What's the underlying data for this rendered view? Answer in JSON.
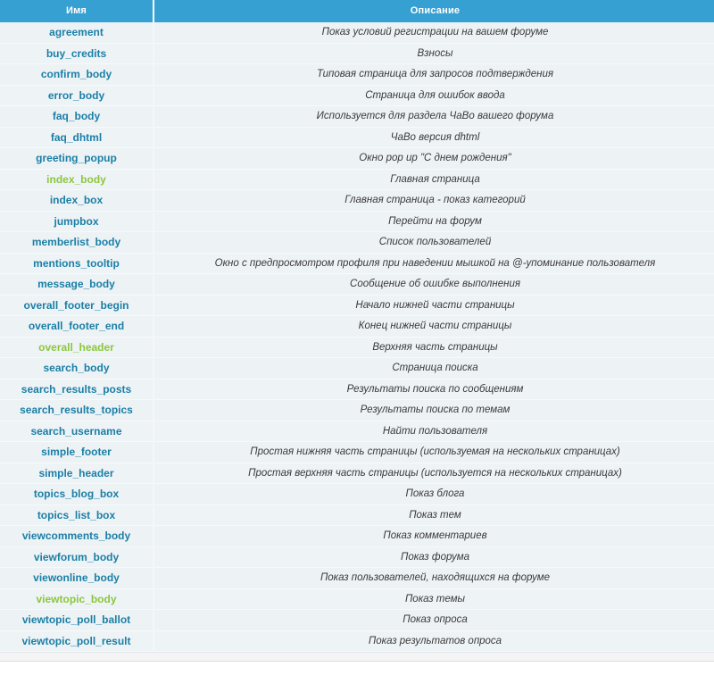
{
  "table": {
    "columns": [
      {
        "key": "name",
        "label": "Имя"
      },
      {
        "key": "description",
        "label": "Описание"
      }
    ],
    "accent_colors": {
      "link_blue": "#1b7fa6",
      "highlight_green": "#8cc63f",
      "header_background": "#37a0d3",
      "header_text": "#ffffff",
      "row_background": "#edf2f5",
      "description_text": "#3a3a3a"
    },
    "rows": [
      {
        "name": "agreement",
        "highlight": false,
        "description": "Показ условий регистрации на вашем форуме"
      },
      {
        "name": "buy_credits",
        "highlight": false,
        "description": "Взносы"
      },
      {
        "name": "confirm_body",
        "highlight": false,
        "description": "Типовая страница для запросов подтверждения"
      },
      {
        "name": "error_body",
        "highlight": false,
        "description": "Страница для ошибок ввода"
      },
      {
        "name": "faq_body",
        "highlight": false,
        "description": "Используется для раздела ЧаВо вашего форума"
      },
      {
        "name": "faq_dhtml",
        "highlight": false,
        "description": "ЧаВо версия dhtml"
      },
      {
        "name": "greeting_popup",
        "highlight": false,
        "description": "Окно pop up \"С днем рождения\""
      },
      {
        "name": "index_body",
        "highlight": true,
        "description": "Главная страница"
      },
      {
        "name": "index_box",
        "highlight": false,
        "description": "Главная страница - показ категорий"
      },
      {
        "name": "jumpbox",
        "highlight": false,
        "description": "Перейти на форум"
      },
      {
        "name": "memberlist_body",
        "highlight": false,
        "description": "Список пользователей"
      },
      {
        "name": "mentions_tooltip",
        "highlight": false,
        "description": "Окно с предпросмотром профиля при наведении мышкой на @-упоминание пользователя"
      },
      {
        "name": "message_body",
        "highlight": false,
        "description": "Сообщение об ошибке выполнения"
      },
      {
        "name": "overall_footer_begin",
        "highlight": false,
        "description": "Начало нижней части страницы"
      },
      {
        "name": "overall_footer_end",
        "highlight": false,
        "description": "Конец нижней части страницы"
      },
      {
        "name": "overall_header",
        "highlight": true,
        "description": "Верхняя часть страницы"
      },
      {
        "name": "search_body",
        "highlight": false,
        "description": "Страница поиска"
      },
      {
        "name": "search_results_posts",
        "highlight": false,
        "description": "Результаты поиска по сообщениям"
      },
      {
        "name": "search_results_topics",
        "highlight": false,
        "description": "Результаты поиска по темам"
      },
      {
        "name": "search_username",
        "highlight": false,
        "description": "Найти пользователя"
      },
      {
        "name": "simple_footer",
        "highlight": false,
        "description": "Простая нижняя часть страницы (используемая на нескольких страницах)"
      },
      {
        "name": "simple_header",
        "highlight": false,
        "description": "Простая верхняя часть страницы (используется на нескольких страницах)"
      },
      {
        "name": "topics_blog_box",
        "highlight": false,
        "description": "Показ блога"
      },
      {
        "name": "topics_list_box",
        "highlight": false,
        "description": "Показ тем"
      },
      {
        "name": "viewcomments_body",
        "highlight": false,
        "description": "Показ комментариев"
      },
      {
        "name": "viewforum_body",
        "highlight": false,
        "description": "Показ форума"
      },
      {
        "name": "viewonline_body",
        "highlight": false,
        "description": "Показ пользователей, находящихся на форуме"
      },
      {
        "name": "viewtopic_body",
        "highlight": true,
        "description": "Показ темы"
      },
      {
        "name": "viewtopic_poll_ballot",
        "highlight": false,
        "description": "Показ опроса"
      },
      {
        "name": "viewtopic_poll_result",
        "highlight": false,
        "description": "Показ результатов опроса"
      }
    ]
  }
}
